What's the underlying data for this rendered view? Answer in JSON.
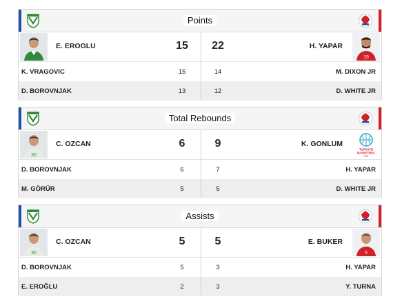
{
  "colors": {
    "home": "#1f4fb0",
    "away": "#d0202a",
    "home_logo": "#2f8a3a"
  },
  "icons": {
    "home_logo": "bursaspor-logo-icon",
    "away_logo": "federation-logo-icon"
  },
  "sections": [
    {
      "title": "Points",
      "leader": {
        "home_name": "E. EROGLU",
        "home_value": "15",
        "away_value": "22",
        "away_name": "H. YAPAR"
      },
      "rows": [
        {
          "home_name": "K. VRAGOVIC",
          "home_value": "15",
          "away_value": "14",
          "away_name": "M. DIXON JR"
        },
        {
          "home_name": "D. BOROVNJAK",
          "home_value": "13",
          "away_value": "12",
          "away_name": "D. WHITE JR"
        }
      ]
    },
    {
      "title": "Total Rebounds",
      "leader": {
        "home_name": "C. OZCAN",
        "home_value": "6",
        "away_value": "9",
        "away_name": "K. GONLUM",
        "away_badge_text": "TÜRKİYE BASKETBOL LİGİ"
      },
      "rows": [
        {
          "home_name": "D. BOROVNJAK",
          "home_value": "6",
          "away_value": "7",
          "away_name": "H. YAPAR"
        },
        {
          "home_name": "M. GÖRÜR",
          "home_value": "5",
          "away_value": "5",
          "away_name": "D. WHITE JR"
        }
      ]
    },
    {
      "title": "Assists",
      "leader": {
        "home_name": "C. OZCAN",
        "home_value": "5",
        "away_value": "5",
        "away_name": "E. BUKER"
      },
      "rows": [
        {
          "home_name": "D. BOROVNJAK",
          "home_value": "5",
          "away_value": "3",
          "away_name": "H. YAPAR"
        },
        {
          "home_name": "E. EROĞLU",
          "home_value": "2",
          "away_value": "3",
          "away_name": "Y. TURNA"
        }
      ]
    }
  ]
}
